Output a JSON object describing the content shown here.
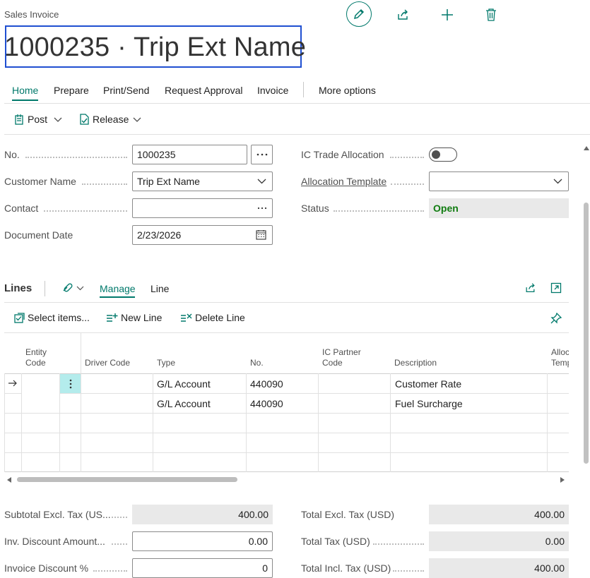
{
  "header": {
    "document_type": "Sales Invoice",
    "title": "1000235 · Trip Ext Name",
    "icons": [
      "edit-icon",
      "share-icon",
      "add-icon",
      "delete-icon"
    ]
  },
  "tabs": [
    "Home",
    "Prepare",
    "Print/Send",
    "Request Approval",
    "Invoice",
    "More options"
  ],
  "actions": {
    "post": "Post",
    "release": "Release"
  },
  "general": {
    "no_label": "No.",
    "no_value": "1000235",
    "customer_label": "Customer Name",
    "customer_value": "Trip Ext Name",
    "contact_label": "Contact",
    "contact_value": "",
    "date_label": "Document Date",
    "date_value": "2/23/2026",
    "ic_label": "IC Trade Allocation",
    "ic_value": false,
    "template_label": "Allocation Template",
    "template_value": "",
    "status_label": "Status",
    "status_value": "Open"
  },
  "lines": {
    "title": "Lines",
    "tabs": [
      "Manage",
      "Line"
    ],
    "actions": {
      "select_items": "Select items...",
      "new_line": "New Line",
      "delete_line": "Delete Line"
    },
    "columns": {
      "entity_1": "Entity",
      "entity_2": "Code",
      "driver": "Driver Code",
      "type": "Type",
      "no": "No.",
      "icp_1": "IC Partner",
      "icp_2": "Code",
      "description": "Description",
      "alloc_1": "Alloc",
      "alloc_2": "Temp"
    },
    "rows": [
      {
        "type": "G/L Account",
        "no": "440090",
        "description": "Customer Rate"
      },
      {
        "type": "G/L Account",
        "no": "440090",
        "description": "Fuel Surcharge"
      }
    ]
  },
  "totals": {
    "subtotal_label": "Subtotal Excl. Tax (US...",
    "subtotal_value": "400.00",
    "inv_disc_amt_label": "Inv. Discount Amount...",
    "inv_disc_amt_value": "0.00",
    "inv_disc_pct_label": "Invoice Discount %",
    "inv_disc_pct_value": "0",
    "total_excl_label": "Total Excl. Tax (USD)",
    "total_excl_value": "400.00",
    "total_tax_label": "Total Tax (USD)",
    "total_tax_value": "0.00",
    "total_incl_label": "Total Incl. Tax (USD)",
    "total_incl_value": "400.00"
  },
  "colors": {
    "accent": "#00796b",
    "status_open": "#107c10",
    "focus": "#1f4fd1"
  }
}
